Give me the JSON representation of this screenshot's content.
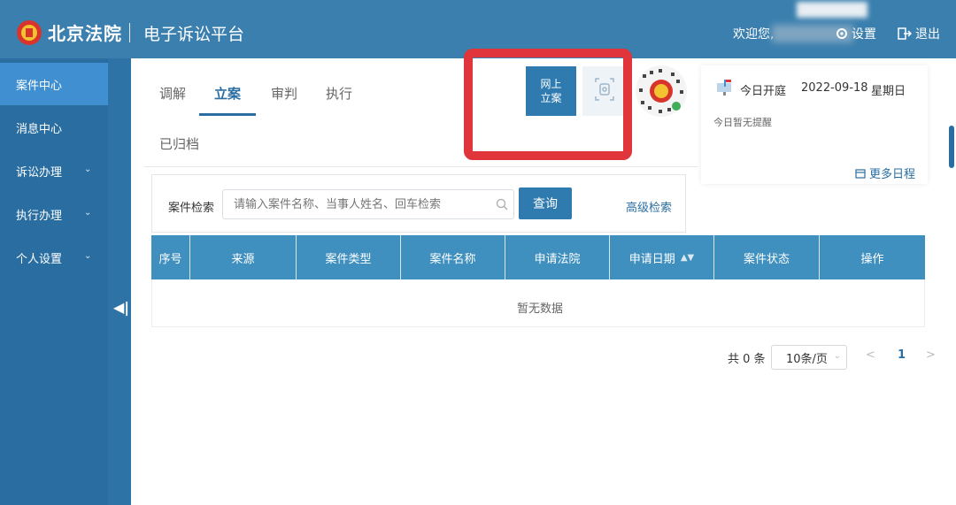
{
  "header": {
    "brand": "北京法院",
    "platform": "电子诉讼平台",
    "welcome": "欢迎您,",
    "settings": "设置",
    "logout": "退出"
  },
  "sidebar": {
    "items": [
      {
        "label": "案件中心",
        "active": true
      },
      {
        "label": "消息中心"
      },
      {
        "label": "诉讼办理",
        "has_submenu": true
      },
      {
        "label": "执行办理",
        "has_submenu": true
      },
      {
        "label": "个人设置",
        "has_submenu": true
      }
    ]
  },
  "tabs": [
    "调解",
    "立案",
    "审判",
    "执行"
  ],
  "active_tab": "立案",
  "archived_tab": "已归档",
  "online_filing": {
    "line1": "网上",
    "line2": "立案"
  },
  "schedule": {
    "title": "今日开庭",
    "date": "2022-09-18",
    "weekday": "星期日",
    "note": "今日暂无提醒",
    "more": "更多日程"
  },
  "search": {
    "label": "案件检索",
    "placeholder": "请输入案件名称、当事人姓名、回车检索",
    "query_button": "查询",
    "advanced": "高级检索"
  },
  "table": {
    "columns": [
      "序号",
      "来源",
      "案件类型",
      "案件名称",
      "申请法院",
      "申请日期",
      "案件状态",
      "操作"
    ],
    "empty_text": "暂无数据"
  },
  "pagination": {
    "total": "共 0 条",
    "per_page": "10条/页",
    "prev": "<",
    "current_page": "1",
    "next": ">"
  },
  "colors": {
    "header": "#3a7fae",
    "sidebar": "#2a6ea1",
    "active_item": "#3f8fd1",
    "table_head": "#3f8fbf",
    "highlight": "#e0353a"
  }
}
